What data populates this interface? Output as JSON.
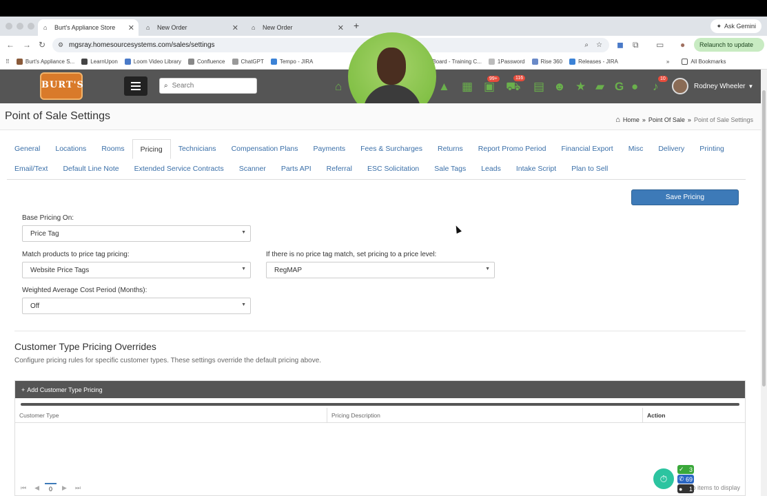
{
  "browser": {
    "tabs": [
      {
        "title": "Burt's Appliance Store",
        "active": true
      },
      {
        "title": "New Order",
        "active": false
      },
      {
        "title": "New Order",
        "active": false
      }
    ],
    "ask_gemini": "Ask Gemini",
    "url": "mgsray.homesourcesystems.com/sales/settings",
    "relaunch": "Relaunch to update",
    "bookmarks": [
      "Burt's Appliance S...",
      "LearnUpon",
      "Loom Video Library",
      "Confluence",
      "ChatGPT",
      "Tempo - JIRA",
      "Board - Training C...",
      "1Password",
      "Rise 360",
      "Releases - JIRA"
    ],
    "all_bookmarks": "All Bookmarks"
  },
  "header": {
    "logo_text": "BURT'S",
    "search_placeholder": "Search",
    "badge_cart": "99+",
    "badge_orders": "116",
    "badge_notifications": "10",
    "user_name": "Rodney Wheeler",
    "accent": "#6ab04c"
  },
  "page": {
    "title": "Point of Sale Settings",
    "breadcrumb": {
      "home": "Home",
      "section": "Point Of Sale",
      "current": "Point of Sale Settings"
    }
  },
  "settings_tabs_row1": [
    "General",
    "Locations",
    "Rooms",
    "Pricing",
    "Technicians",
    "Compensation Plans",
    "Payments",
    "Fees & Surcharges",
    "Returns",
    "Report Promo Period",
    "Financial Export",
    "Misc",
    "Delivery",
    "Printing"
  ],
  "settings_tabs_row2": [
    "Email/Text",
    "Default Line Note",
    "Extended Service Contracts",
    "Scanner",
    "Parts API",
    "Referral",
    "ESC Solicitation",
    "Sale Tags",
    "Leads",
    "Intake Script",
    "Plan to Sell"
  ],
  "active_tab": "Pricing",
  "form": {
    "save_label": "Save Pricing",
    "base_pricing_label": "Base Pricing On:",
    "base_pricing_value": "Price Tag",
    "match_label": "Match products to price tag pricing:",
    "match_value": "Website Price Tags",
    "no_match_label": "If there is no price tag match, set pricing to a price level:",
    "no_match_value": "RegMAP",
    "wac_label": "Weighted Average Cost Period (Months):",
    "wac_value": "Off"
  },
  "overrides": {
    "title": "Customer Type Pricing Overrides",
    "subtitle": "Configure pricing rules for specific customer types. These settings override the default pricing above.",
    "add_button": "Add Customer Type Pricing",
    "columns": [
      "Customer Type",
      "Pricing Description",
      "Action"
    ],
    "page_number": "0",
    "no_items": "No items to display"
  },
  "widgets": {
    "count_green": "3",
    "count_blue": "69",
    "count_dark": "1"
  }
}
